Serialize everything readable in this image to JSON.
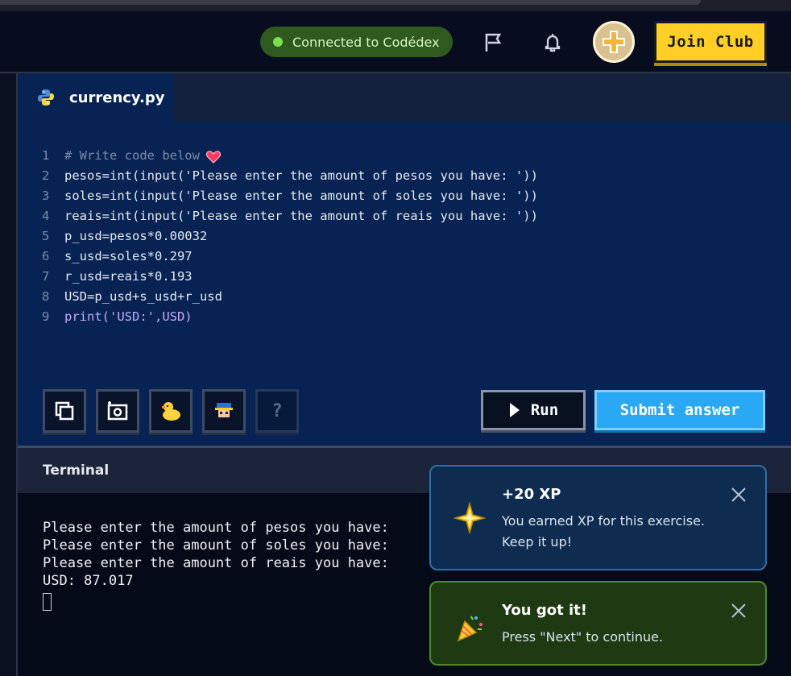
{
  "header": {
    "connection_status": "Connected to Codédex",
    "join_label": "Join Club",
    "status_color": "#7be04f",
    "accent_color": "#ffcf26"
  },
  "editor": {
    "tab_name": "currency.py",
    "lines": [
      {
        "n": "1",
        "text": "# Write code below"
      },
      {
        "n": "2",
        "text": "pesos=int(input('Please enter the amount of pesos you have: '))"
      },
      {
        "n": "3",
        "text": "soles=int(input('Please enter the amount of soles you have: '))"
      },
      {
        "n": "4",
        "text": "reais=int(input('Please enter the amount of reais you have: '))"
      },
      {
        "n": "5",
        "text": "p_usd=pesos*0.00032"
      },
      {
        "n": "6",
        "text": "s_usd=soles*0.297"
      },
      {
        "n": "7",
        "text": "r_usd=reais*0.193"
      },
      {
        "n": "8",
        "text": "USD=p_usd+s_usd+r_usd"
      },
      {
        "n": "9",
        "text": "print('USD:',USD)"
      }
    ],
    "run_label": "Run",
    "submit_label": "Submit answer",
    "help_label": "?"
  },
  "terminal": {
    "title": "Terminal",
    "output": [
      "Please enter the amount of pesos you have: ",
      "Please enter the amount of soles you have: ",
      "Please enter the amount of reais you have: ",
      "USD: 87.017"
    ]
  },
  "toasts": {
    "xp": {
      "title": "+20 XP",
      "body": "You earned XP for this exercise. Keep it up!"
    },
    "success": {
      "title": "You got it!",
      "body": "Press \"Next\" to continue."
    }
  }
}
